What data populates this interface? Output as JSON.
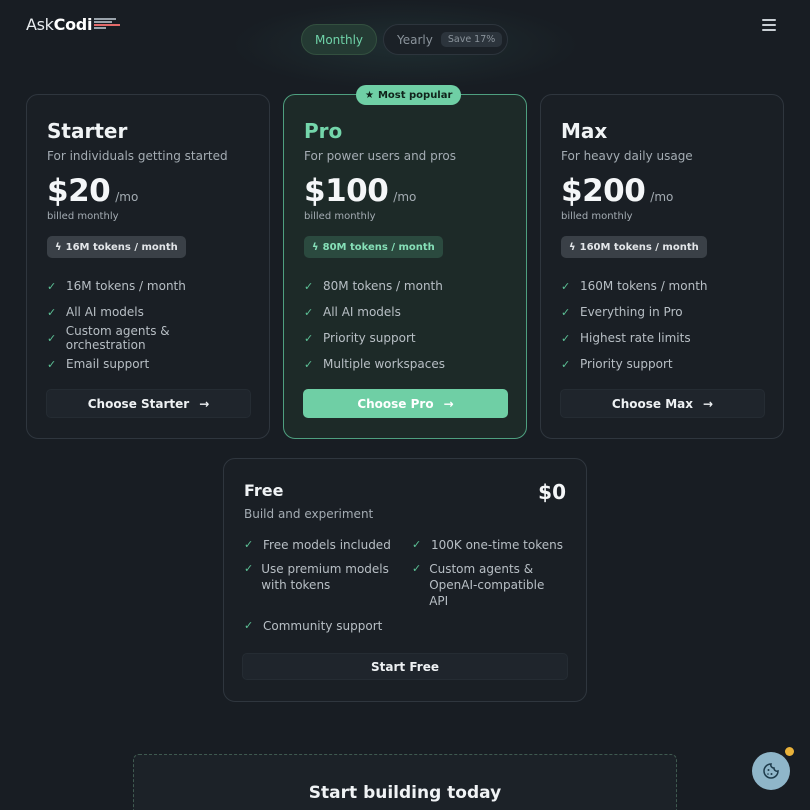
{
  "brand": {
    "ask": "Ask",
    "codi": "Codi"
  },
  "billing_toggle": {
    "monthly": "Monthly",
    "yearly": "Yearly",
    "save_badge": "Save 17%"
  },
  "plans": [
    {
      "name": "Starter",
      "subtitle": "For individuals getting started",
      "price": "$20",
      "period": "/mo",
      "billed": "billed monthly",
      "tokens_badge": "16M tokens / month",
      "features": [
        "16M tokens / month",
        "All AI models",
        "Custom agents & orchestration",
        "Email support"
      ],
      "cta": "Choose Starter"
    },
    {
      "name": "Pro",
      "subtitle": "For power users and pros",
      "price": "$100",
      "period": "/mo",
      "billed": "billed monthly",
      "tokens_badge": "80M tokens / month",
      "badge": "Most popular",
      "features": [
        "80M tokens / month",
        "All AI models",
        "Priority support",
        "Multiple workspaces"
      ],
      "cta": "Choose Pro"
    },
    {
      "name": "Max",
      "subtitle": "For heavy daily usage",
      "price": "$200",
      "period": "/mo",
      "billed": "billed monthly",
      "tokens_badge": "160M tokens / month",
      "features": [
        "160M tokens / month",
        "Everything in Pro",
        "Highest rate limits",
        "Priority support"
      ],
      "cta": "Choose Max"
    }
  ],
  "free_plan": {
    "name": "Free",
    "price": "$0",
    "subtitle": "Build and experiment",
    "features": [
      "Free models included",
      "100K one-time tokens",
      "Use premium models with tokens",
      "Custom agents & OpenAI-compatible API",
      "Community support"
    ],
    "cta": "Start Free"
  },
  "banner": {
    "title": "Start building today"
  },
  "icons": {
    "menu": "hamburger-icon",
    "check": "check-icon",
    "arrow": "arrow-right-icon",
    "bolt": "bolt-icon",
    "star": "star-icon",
    "cookie": "cookie-icon"
  },
  "colors": {
    "accent": "#6fcfa5",
    "background": "#181d23",
    "card": "#1a1f25"
  }
}
